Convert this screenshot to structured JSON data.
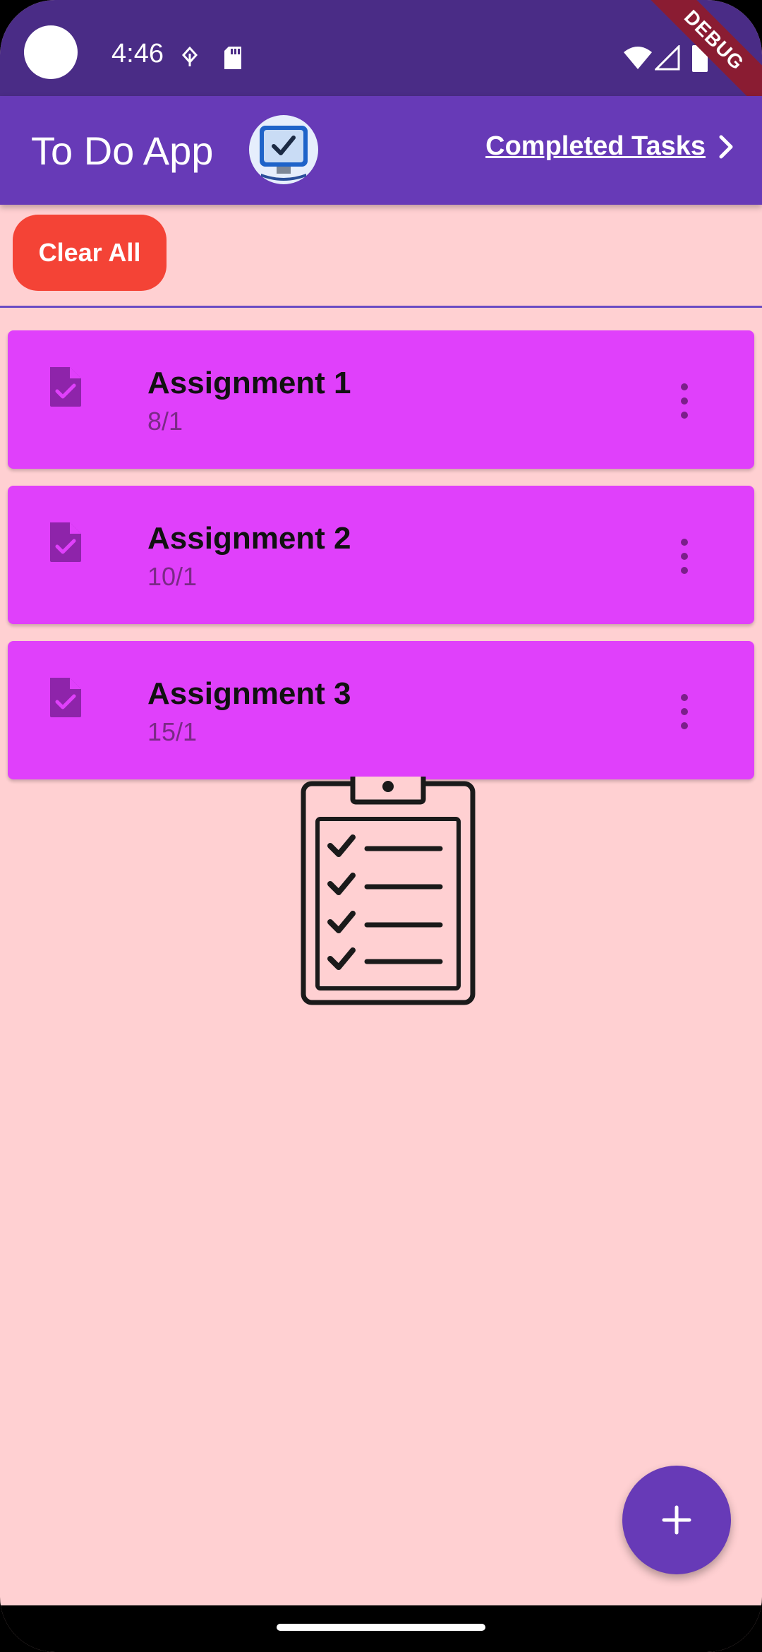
{
  "status_bar": {
    "time": "4:46"
  },
  "debug_banner": "DEBUG",
  "app_bar": {
    "title": "To Do App",
    "completed_link": "Completed Tasks"
  },
  "actions": {
    "clear_all": "Clear All"
  },
  "tasks": [
    {
      "title": "Assignment 1",
      "date": "8/1"
    },
    {
      "title": "Assignment 2",
      "date": "10/1"
    },
    {
      "title": "Assignment 3",
      "date": "15/1"
    }
  ],
  "colors": {
    "status_bar": "#4a2c86",
    "app_bar": "#673ab7",
    "background": "#ffd0d2",
    "card": "#e040fb",
    "clear_button": "#f44336",
    "fab": "#673ab7"
  },
  "icons": {
    "task": "task-file-check-icon",
    "menu": "more-vert-icon",
    "fab": "plus-icon",
    "completed": "chevron-right-icon"
  }
}
